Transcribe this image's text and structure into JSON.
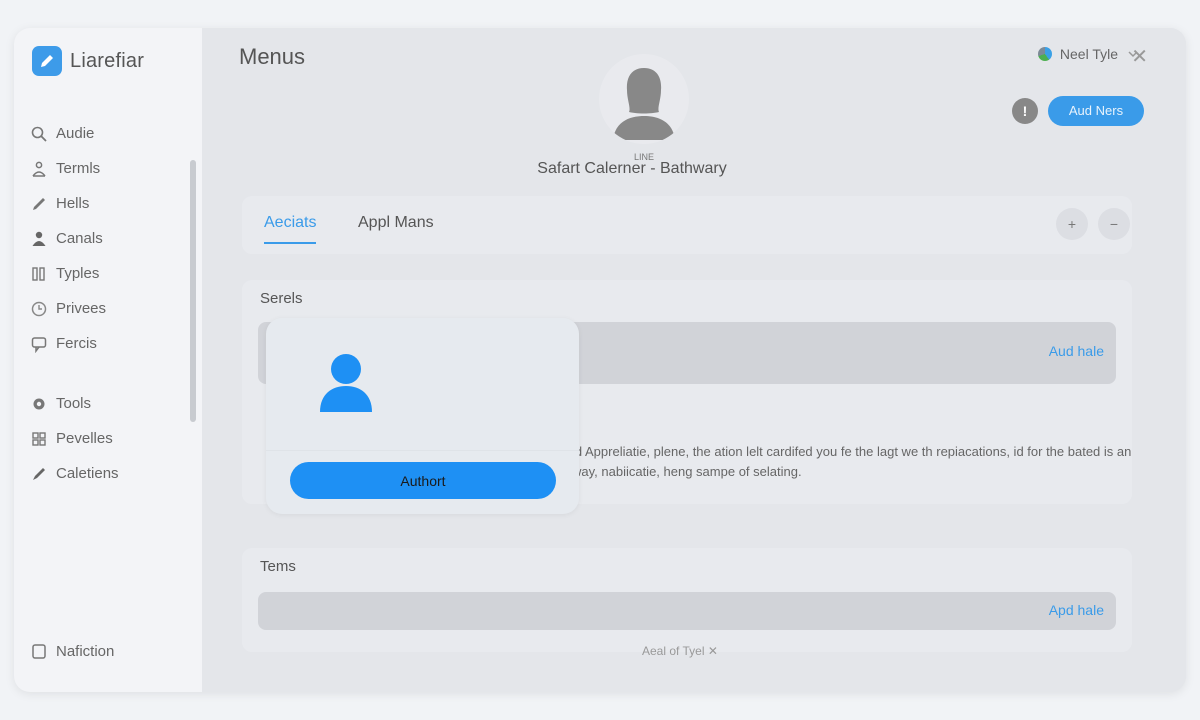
{
  "app": {
    "name": "Liarefiar"
  },
  "sidebar": {
    "items": [
      {
        "label": "Audie",
        "icon": "search-icon"
      },
      {
        "label": "Termls",
        "icon": "person-outline-icon"
      },
      {
        "label": "Hells",
        "icon": "pencil-icon"
      },
      {
        "label": "Canals",
        "icon": "person-filled-icon"
      },
      {
        "label": "Typles",
        "icon": "grid-icon"
      },
      {
        "label": "Privees",
        "icon": "clock-icon"
      },
      {
        "label": "Fercis",
        "icon": "chat-icon"
      }
    ],
    "items2": [
      {
        "label": "Tools",
        "icon": "gear-icon"
      },
      {
        "label": "Pevelles",
        "icon": "grid2-icon"
      },
      {
        "label": "Caletiens",
        "icon": "brush-icon"
      }
    ],
    "footer": {
      "label": "Nafiction",
      "icon": "square-icon"
    }
  },
  "header": {
    "title": "Menus",
    "user_name": "Neel Tyle",
    "add_button": "Aud Ners",
    "help_label": "!"
  },
  "profile": {
    "sub": "LINE",
    "name": "Safart Calerner - Bathwary"
  },
  "tabs": {
    "active": "Aeciats",
    "other": "Appl Mans",
    "icon_plus": "+",
    "icon_minus": "−"
  },
  "sections": {
    "first": {
      "title": "Serels",
      "row_link": "Aud hale",
      "description": "id Appreliatie, plene, the ation lelt cardifed you fe the lagt we th repiacations, id for the bated is an way, nabiicatie, heng sampe of selating."
    },
    "second": {
      "title": "Tems",
      "row_link": "Apd hale"
    }
  },
  "footer_note": "Aeal of Tyel ✕",
  "popover": {
    "button": "Authort"
  },
  "colors": {
    "accent": "#3a9be9",
    "popover_button": "#1e90f4"
  }
}
